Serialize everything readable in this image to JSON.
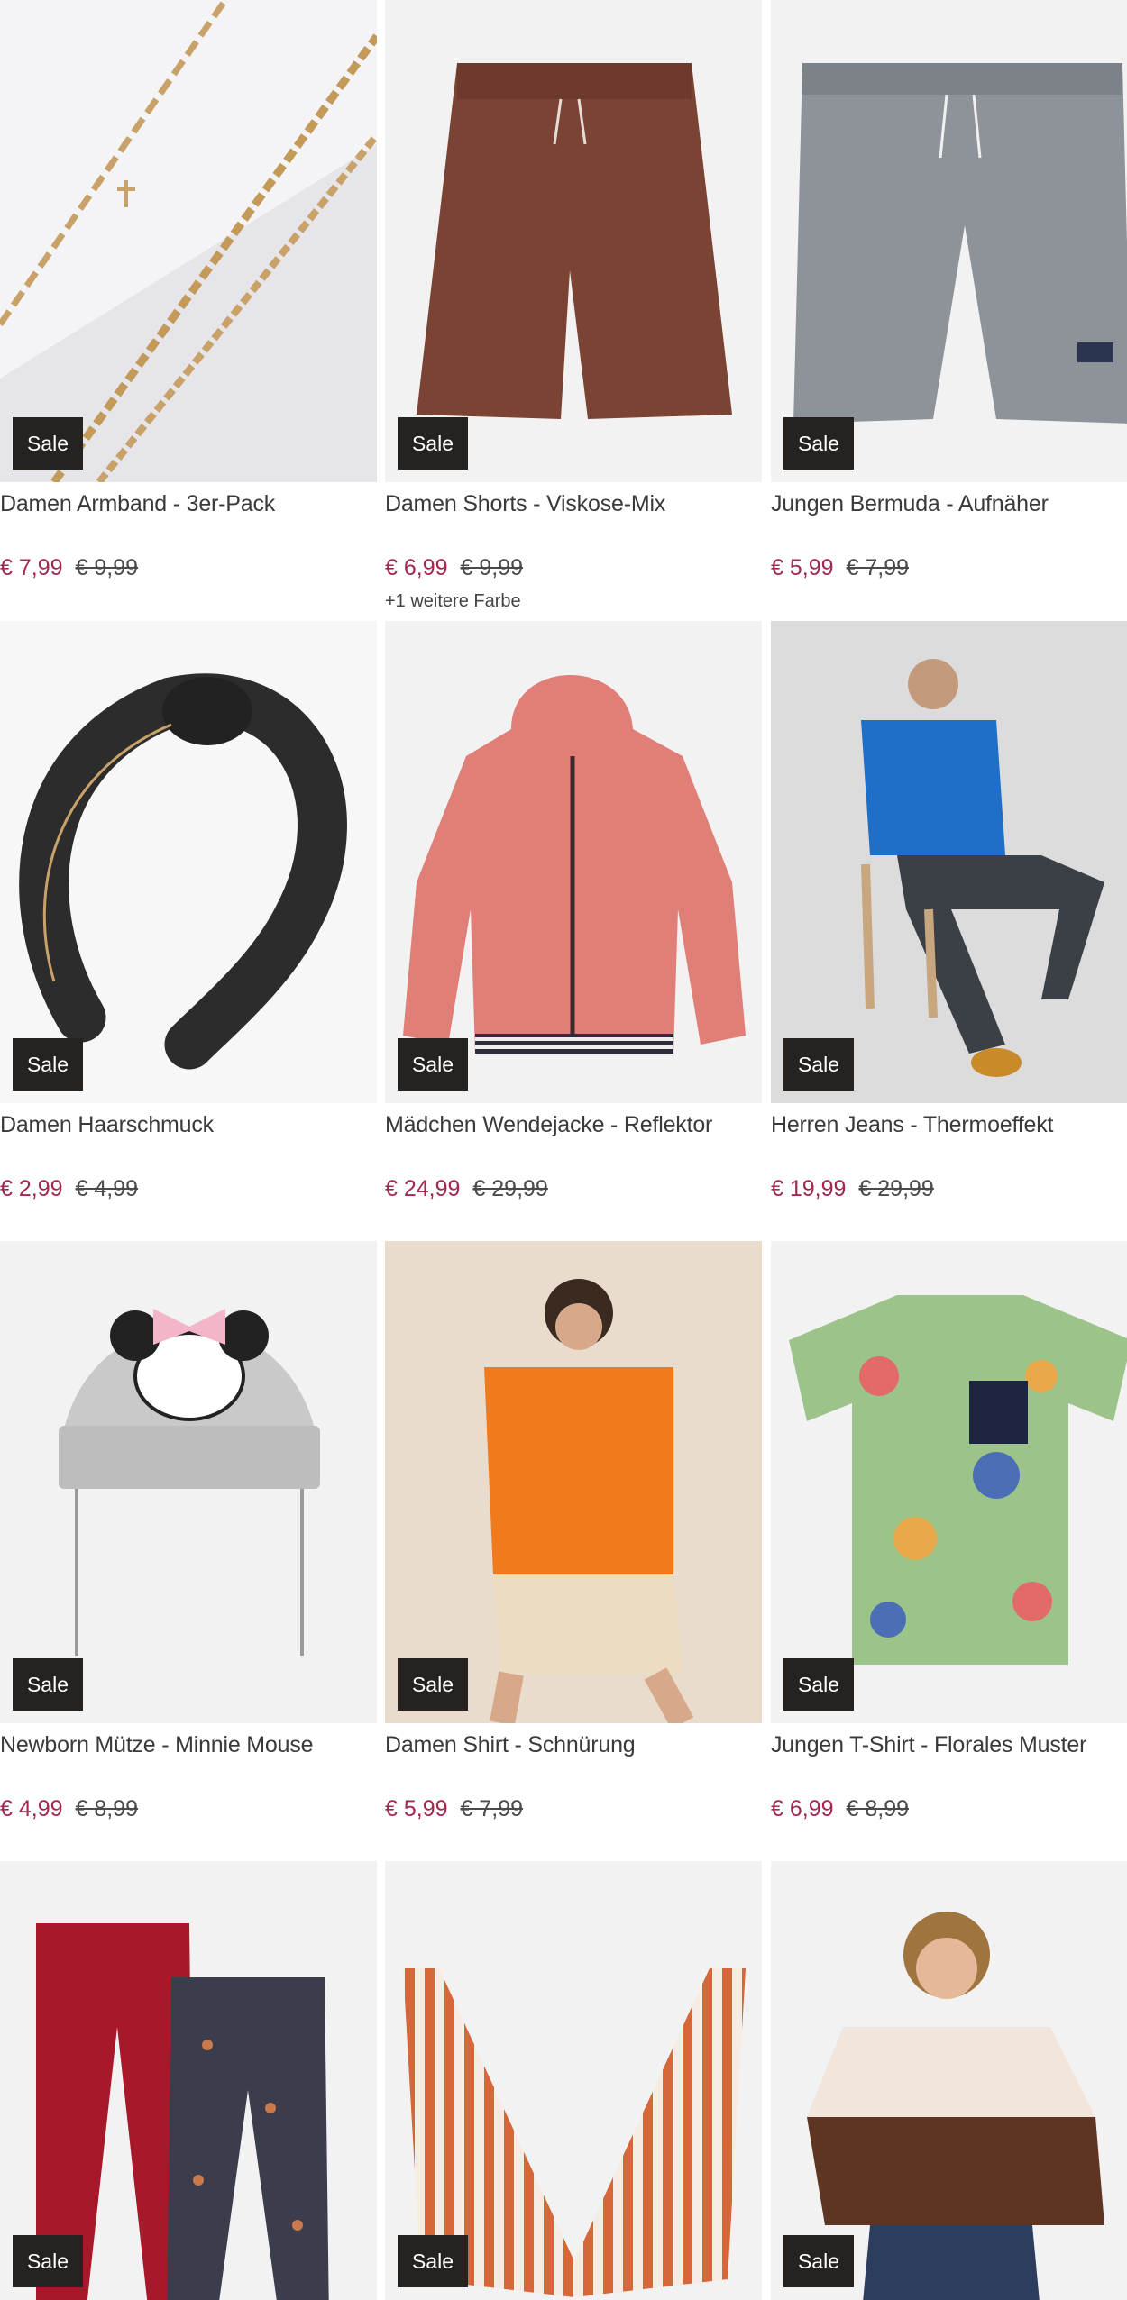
{
  "badge_label": "Sale",
  "colors": {
    "price": "#a3284e",
    "badge_bg": "#262220"
  },
  "products": [
    {
      "title": "Damen Armband - 3er-Pack",
      "price": "€ 7,99",
      "old_price": "€ 9,99",
      "extra": ""
    },
    {
      "title": "Damen Shorts - Viskose-Mix",
      "price": "€ 6,99",
      "old_price": "€ 9,99",
      "extra": "+1 weitere Farbe"
    },
    {
      "title": "Jungen Bermuda - Aufnäher",
      "price": "€ 5,99",
      "old_price": "€ 7,99",
      "extra": ""
    },
    {
      "title": "Damen Haarschmuck",
      "price": "€ 2,99",
      "old_price": "€ 4,99",
      "extra": ""
    },
    {
      "title": "Mädchen Wendejacke - Reflektor",
      "price": "€ 24,99",
      "old_price": "€ 29,99",
      "extra": ""
    },
    {
      "title": "Herren Jeans - Thermoeffekt",
      "price": "€ 19,99",
      "old_price": "€ 29,99",
      "extra": ""
    },
    {
      "title": "Newborn Mütze - Minnie Mouse",
      "price": "€ 4,99",
      "old_price": "€ 8,99",
      "extra": ""
    },
    {
      "title": "Damen Shirt - Schnürung",
      "price": "€ 5,99",
      "old_price": "€ 7,99",
      "extra": ""
    },
    {
      "title": "Jungen T-Shirt - Florales Muster",
      "price": "€ 6,99",
      "old_price": "€ 8,99",
      "extra": ""
    },
    {
      "title": "",
      "price": "",
      "old_price": "",
      "extra": ""
    },
    {
      "title": "",
      "price": "",
      "old_price": "",
      "extra": ""
    },
    {
      "title": "",
      "price": "",
      "old_price": "",
      "extra": ""
    }
  ]
}
